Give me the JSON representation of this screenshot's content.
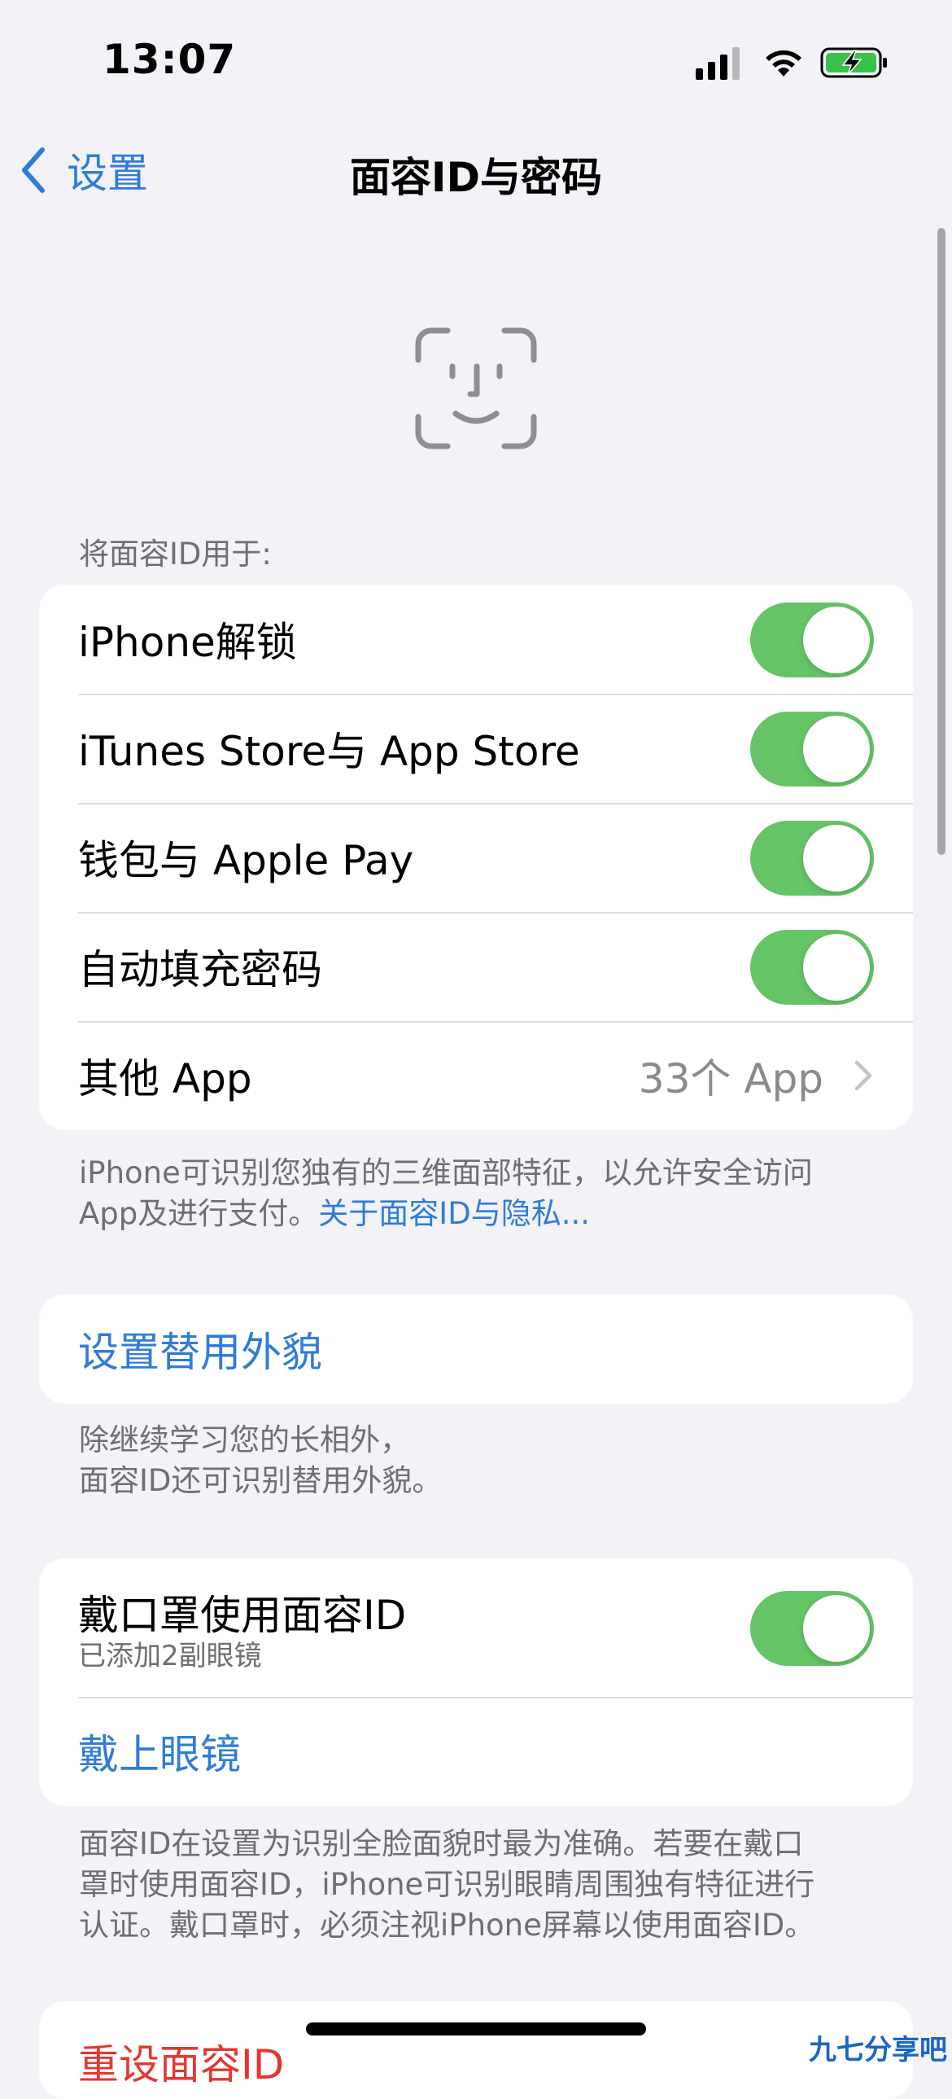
{
  "status_bar": {
    "time": "13:07"
  },
  "nav": {
    "back_label": "设置",
    "title": "面容ID与密码"
  },
  "section_use": {
    "header": "将面容ID用于:",
    "rows": [
      {
        "label": "iPhone解锁",
        "toggle_on": true
      },
      {
        "label": "iTunes Store与 App Store",
        "toggle_on": true
      },
      {
        "label": "钱包与 Apple Pay",
        "toggle_on": true
      },
      {
        "label": "自动填充密码",
        "toggle_on": true
      }
    ],
    "other_apps": {
      "label": "其他 App",
      "value": "33个 App"
    },
    "footer_line1": "iPhone可识别您独有的三维面部特征，以允许安全访问",
    "footer_line2_prefix": "App及进行支付。",
    "footer_link": "关于面容ID与隐私..."
  },
  "section_alt": {
    "button_label": "设置替用外貌",
    "footer_line1": "除继续学习您的长相外，",
    "footer_line2": "面容ID还可识别替用外貌。"
  },
  "section_mask": {
    "label": "戴口罩使用面容ID",
    "sublabel": "已添加2副眼镜",
    "toggle_on": true,
    "glasses_label": "戴上眼镜",
    "footer_line1": "面容ID在设置为识别全脸面貌时最为准确。若要在戴口",
    "footer_line2": "罩时使用面容ID，iPhone可识别眼睛周围独有特征进行",
    "footer_line3": "认证。戴口罩时，必须注视iPhone屏幕以使用面容ID。"
  },
  "reset": {
    "label": "重设面容ID"
  },
  "watermark": "九七分享吧",
  "colors": {
    "accent": "#2f7cd8",
    "toggle_on": "#65c466",
    "destructive": "#e5362f",
    "background": "#f2f2f7"
  },
  "icons": [
    "signal-icon",
    "wifi-icon",
    "battery-charging-icon",
    "chevron-left-icon",
    "face-id-icon",
    "chevron-right-icon"
  ]
}
